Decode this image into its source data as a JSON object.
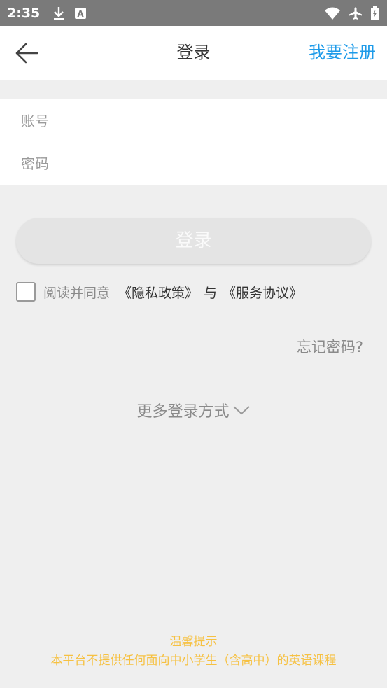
{
  "status_bar": {
    "time": "2:35"
  },
  "header": {
    "title": "登录",
    "register_label": "我要注册"
  },
  "form": {
    "account_placeholder": "账号",
    "password_placeholder": "密码"
  },
  "login_button_label": "登录",
  "agreement": {
    "prefix": "阅读并同意",
    "privacy_link": "《隐私政策》",
    "conjunction": "与",
    "service_link": "《服务协议》",
    "checked": false
  },
  "forgot_password": "忘记密码?",
  "more_login": "更多登录方式",
  "notice": {
    "title": "温馨提示",
    "text": "本平台不提供任何面向中小学生（含高中）的英语课程"
  },
  "colors": {
    "accent": "#1e9be9",
    "notice": "#f6c142",
    "statusbar": "#7a7a7a"
  }
}
